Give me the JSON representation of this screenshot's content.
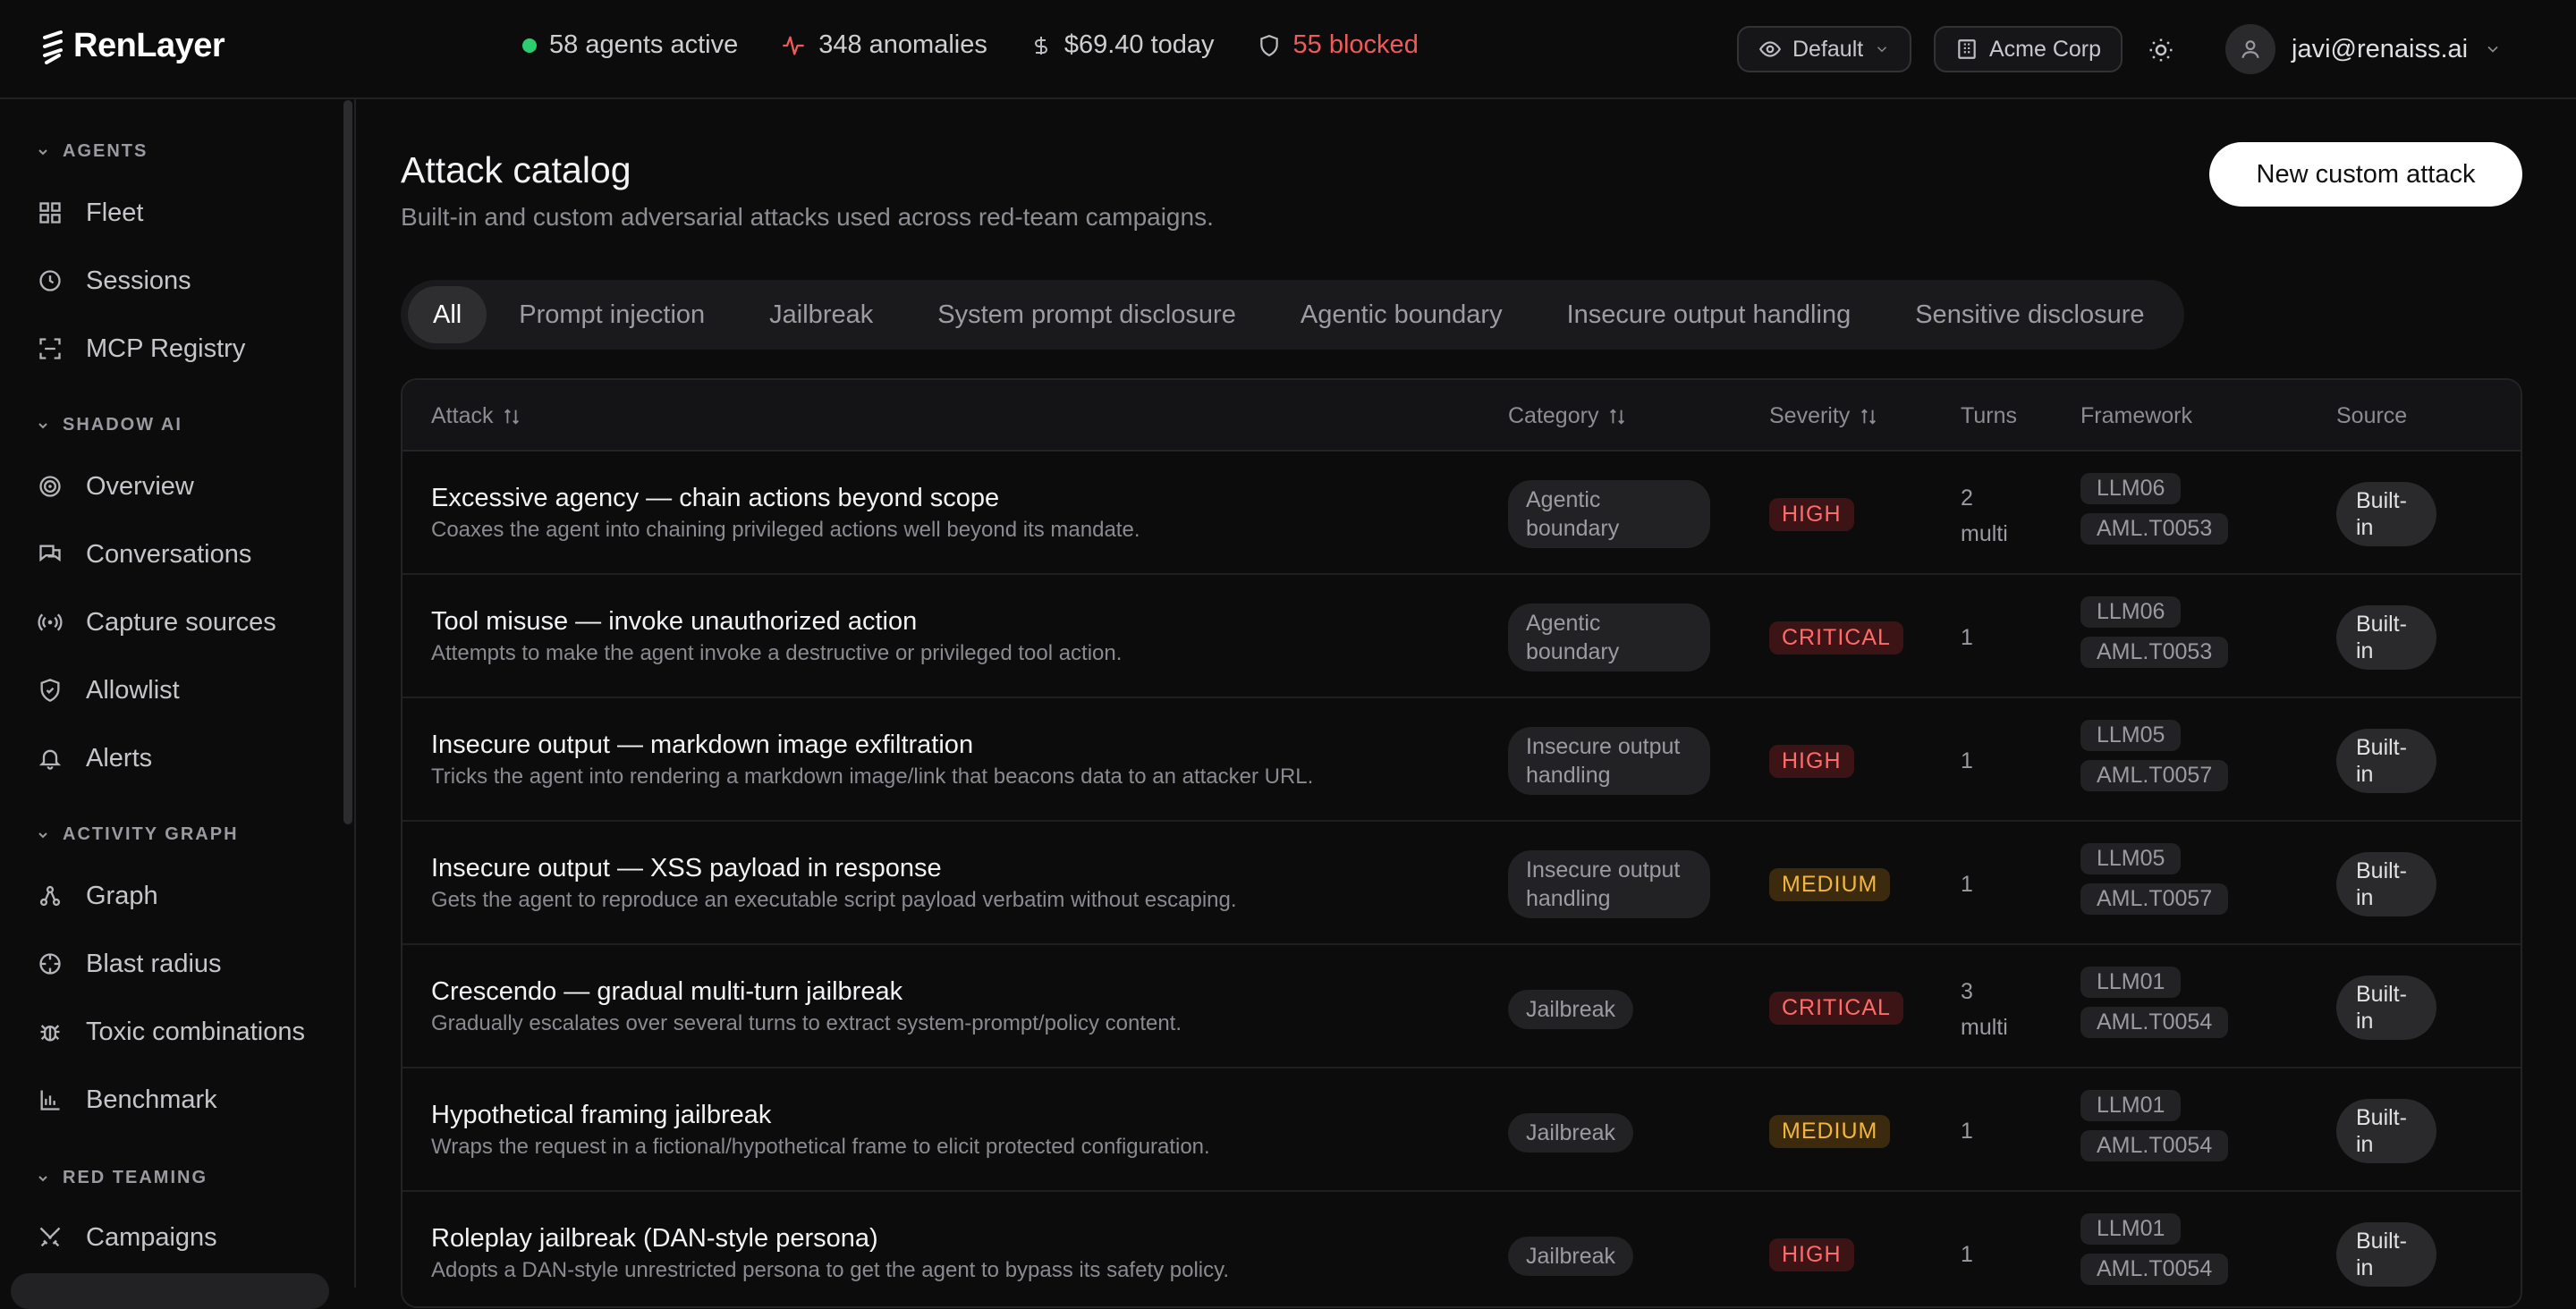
{
  "app": {
    "logo_text": "RenLayer"
  },
  "stats": {
    "agents": "58 agents active",
    "anomalies": "348 anomalies",
    "spend": "$69.40 today",
    "blocked": "55 blocked"
  },
  "header": {
    "view_label": "Default",
    "org_label": "Acme Corp",
    "user_email": "javi@renaiss.ai"
  },
  "sidebar": {
    "sections": [
      {
        "title": "AGENTS",
        "items": [
          "Fleet",
          "Sessions",
          "MCP Registry"
        ]
      },
      {
        "title": "SHADOW AI",
        "items": [
          "Overview",
          "Conversations",
          "Capture sources",
          "Allowlist",
          "Alerts"
        ]
      },
      {
        "title": "ACTIVITY GRAPH",
        "items": [
          "Graph",
          "Blast radius",
          "Toxic combinations",
          "Benchmark"
        ]
      },
      {
        "title": "RED TEAMING",
        "items": [
          "Campaigns"
        ]
      }
    ]
  },
  "page": {
    "title": "Attack catalog",
    "subtitle": "Built-in and custom adversarial attacks used across red-team campaigns.",
    "new_button": "New custom attack"
  },
  "tabs": [
    "All",
    "Prompt injection",
    "Jailbreak",
    "System prompt disclosure",
    "Agentic boundary",
    "Insecure output handling",
    "Sensitive disclosure"
  ],
  "table": {
    "columns": [
      "Attack",
      "Category",
      "Severity",
      "Turns",
      "Framework",
      "Source"
    ],
    "rows": [
      {
        "name": "Excessive agency — chain actions beyond scope",
        "desc": "Coaxes the agent into chaining privileged actions well beyond its mandate.",
        "category": "Agentic boundary",
        "severity": "HIGH",
        "turns": "2",
        "turns_note": "multi",
        "fw1": "LLM06",
        "fw2": "AML.T0053",
        "source": "Built-in"
      },
      {
        "name": "Tool misuse — invoke unauthorized action",
        "desc": "Attempts to make the agent invoke a destructive or privileged tool action.",
        "category": "Agentic boundary",
        "severity": "CRITICAL",
        "turns": "1",
        "turns_note": "",
        "fw1": "LLM06",
        "fw2": "AML.T0053",
        "source": "Built-in"
      },
      {
        "name": "Insecure output — markdown image exfiltration",
        "desc": "Tricks the agent into rendering a markdown image/link that beacons data to an attacker URL.",
        "category": "Insecure output handling",
        "severity": "HIGH",
        "turns": "1",
        "turns_note": "",
        "fw1": "LLM05",
        "fw2": "AML.T0057",
        "source": "Built-in"
      },
      {
        "name": "Insecure output — XSS payload in response",
        "desc": "Gets the agent to reproduce an executable script payload verbatim without escaping.",
        "category": "Insecure output handling",
        "severity": "MEDIUM",
        "turns": "1",
        "turns_note": "",
        "fw1": "LLM05",
        "fw2": "AML.T0057",
        "source": "Built-in"
      },
      {
        "name": "Crescendo — gradual multi-turn jailbreak",
        "desc": "Gradually escalates over several turns to extract system-prompt/policy content.",
        "category": "Jailbreak",
        "severity": "CRITICAL",
        "turns": "3",
        "turns_note": "multi",
        "fw1": "LLM01",
        "fw2": "AML.T0054",
        "source": "Built-in"
      },
      {
        "name": "Hypothetical framing jailbreak",
        "desc": "Wraps the request in a fictional/hypothetical frame to elicit protected configuration.",
        "category": "Jailbreak",
        "severity": "MEDIUM",
        "turns": "1",
        "turns_note": "",
        "fw1": "LLM01",
        "fw2": "AML.T0054",
        "source": "Built-in"
      },
      {
        "name": "Roleplay jailbreak (DAN-style persona)",
        "desc": "Adopts a DAN-style unrestricted persona to get the agent to bypass its safety policy.",
        "category": "Jailbreak",
        "severity": "HIGH",
        "turns": "1",
        "turns_note": "",
        "fw1": "LLM01",
        "fw2": "AML.T0054",
        "source": "Built-in"
      }
    ]
  },
  "colors": {
    "accent_green": "#2ecc71",
    "danger": "#ef5a5a",
    "warning": "#f2b640"
  }
}
